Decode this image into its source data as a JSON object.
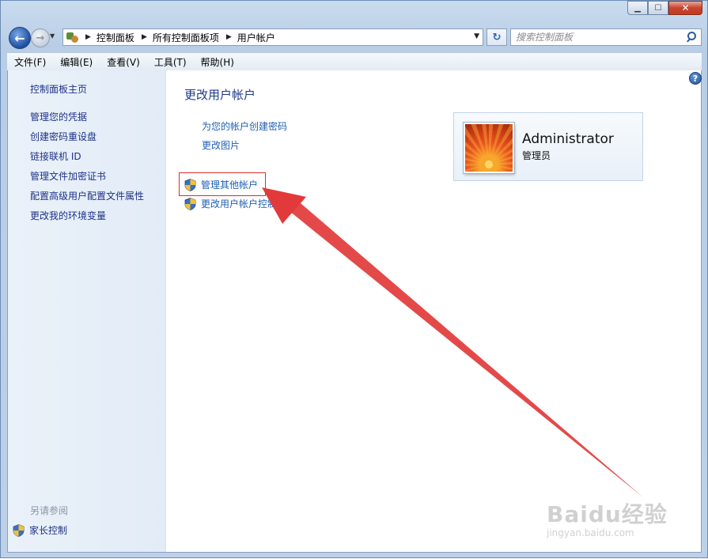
{
  "window": {
    "minimize_symbol": "▁",
    "maximize_symbol": "☐",
    "close_symbol": "✕"
  },
  "nav": {
    "back_icon": "arrow-left-icon",
    "forward_icon": "arrow-right-icon",
    "breadcrumb": [
      "控制面板",
      "所有控制面板项",
      "用户帐户"
    ],
    "search_placeholder": "搜索控制面板"
  },
  "menu": [
    "文件(F)",
    "编辑(E)",
    "查看(V)",
    "工具(T)",
    "帮助(H)"
  ],
  "sidebar": {
    "home": "控制面板主页",
    "links": [
      "管理您的凭据",
      "创建密码重设盘",
      "链接联机 ID",
      "管理文件加密证书",
      "配置高级用户配置文件属性",
      "更改我的环境变量"
    ],
    "see_also_label": "另请参阅",
    "parental": "家长控制"
  },
  "main": {
    "title": "更改用户帐户",
    "links": [
      "为您的帐户创建密码",
      "更改图片"
    ],
    "admin_links": [
      "管理其他帐户",
      "更改用户帐户控制设置"
    ]
  },
  "user": {
    "name": "Administrator",
    "role": "管理员"
  },
  "watermark": {
    "logo": "Baidu经验",
    "url": "jingyan.baidu.com"
  },
  "colors": {
    "link": "#1e5fb4",
    "sidebar_link": "#1e3287",
    "annotation_red": "#e02b2b"
  }
}
